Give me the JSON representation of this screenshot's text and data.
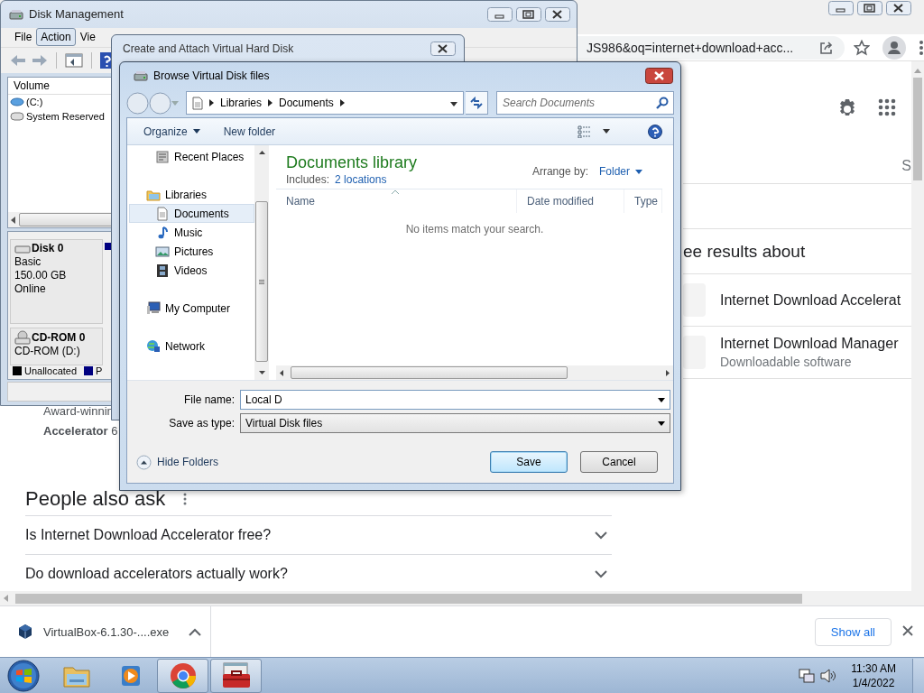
{
  "browser": {
    "url": "JS986&oq=internet+download+acc...",
    "snippet": [
      "Award-winnin",
      "**Accelerator** 6"
    ],
    "people_also_ask": {
      "title": "People also ask",
      "questions": [
        {
          "text": "Is Internet Download Accelerator free?",
          "expanded": false
        },
        {
          "text": "Do download accelerators actually work?",
          "expanded": false
        }
      ]
    },
    "side_heading": "S",
    "see_results": {
      "title": "ee results about",
      "items": [
        {
          "title": "Internet Download Accelerat"
        },
        {
          "title": "Internet Download Manager",
          "subtitle": "Downloadable software"
        }
      ]
    },
    "downloads": {
      "items": [
        {
          "file": "VirtualBox-6.1.30-....exe"
        }
      ],
      "show_all": "Show all"
    }
  },
  "disk_management": {
    "title": "Disk Management",
    "menu": [
      {
        "label": "File",
        "selected": false
      },
      {
        "label": "Action",
        "selected": true
      },
      {
        "label": "Vie",
        "selected": false
      }
    ],
    "volume_header": "Volume",
    "volumes": [
      {
        "name": "(C:)",
        "kind": "boot"
      },
      {
        "name": "System Reserved",
        "kind": "reserved"
      }
    ],
    "disks": [
      {
        "kind": "disk",
        "name": "Disk 0",
        "details": [
          "Basic",
          "150.00 GB",
          "Online"
        ]
      },
      {
        "kind": "cdrom",
        "name": "CD-ROM 0",
        "details": [
          "CD-ROM (D:)"
        ]
      }
    ],
    "legend": [
      {
        "label": "Unallocated",
        "color": "#000000"
      },
      {
        "label": "P",
        "color": "#000080"
      }
    ]
  },
  "create_vhd": {
    "title": "Create and Attach Virtual Hard Disk"
  },
  "browse_dialog": {
    "title": "Browse Virtual Disk files",
    "path": [
      "Libraries",
      "Documents"
    ],
    "search_placeholder": "Search Documents",
    "toolbar": [
      {
        "label": "Organize",
        "dropdown": true
      },
      {
        "label": "New folder",
        "dropdown": false
      }
    ],
    "nav": {
      "favorites": [
        {
          "label": "Recent Places",
          "kind": "recent",
          "selected": false
        }
      ],
      "groups": [
        {
          "label": "Libraries",
          "kind": "libraries",
          "selected": false,
          "children": [
            {
              "label": "Documents",
              "kind": "documents",
              "selected": true
            },
            {
              "label": "Music",
              "kind": "music",
              "selected": false
            },
            {
              "label": "Pictures",
              "kind": "pictures",
              "selected": false
            },
            {
              "label": "Videos",
              "kind": "videos",
              "selected": false
            }
          ]
        },
        {
          "label": "My Computer",
          "kind": "computer",
          "selected": false
        },
        {
          "label": "Network",
          "kind": "network",
          "selected": false
        }
      ]
    },
    "library": {
      "title": "Documents library",
      "includes_label": "Includes:",
      "locations": "2 locations",
      "arrange_label": "Arrange by:",
      "arrange_value": "Folder"
    },
    "columns": [
      {
        "label": "Name",
        "sorted": true
      },
      {
        "label": "Date modified",
        "sorted": false
      },
      {
        "label": "Type",
        "sorted": false
      }
    ],
    "empty_message": "No items match your search.",
    "file_name": {
      "label": "File name:",
      "value": "Local D"
    },
    "save_type": {
      "label": "Save as type:",
      "value": "Virtual Disk files"
    },
    "hide_folders": "Hide Folders",
    "buttons": [
      {
        "label": "Save",
        "default": true
      },
      {
        "label": "Cancel",
        "default": false
      }
    ]
  },
  "taskbar": {
    "apps": [
      {
        "kind": "explorer",
        "open": false
      },
      {
        "kind": "media",
        "open": false
      },
      {
        "kind": "chrome",
        "open": true
      },
      {
        "kind": "toolbox",
        "open": true
      }
    ],
    "time": "11:30 AM",
    "date": "1/4/2022"
  }
}
